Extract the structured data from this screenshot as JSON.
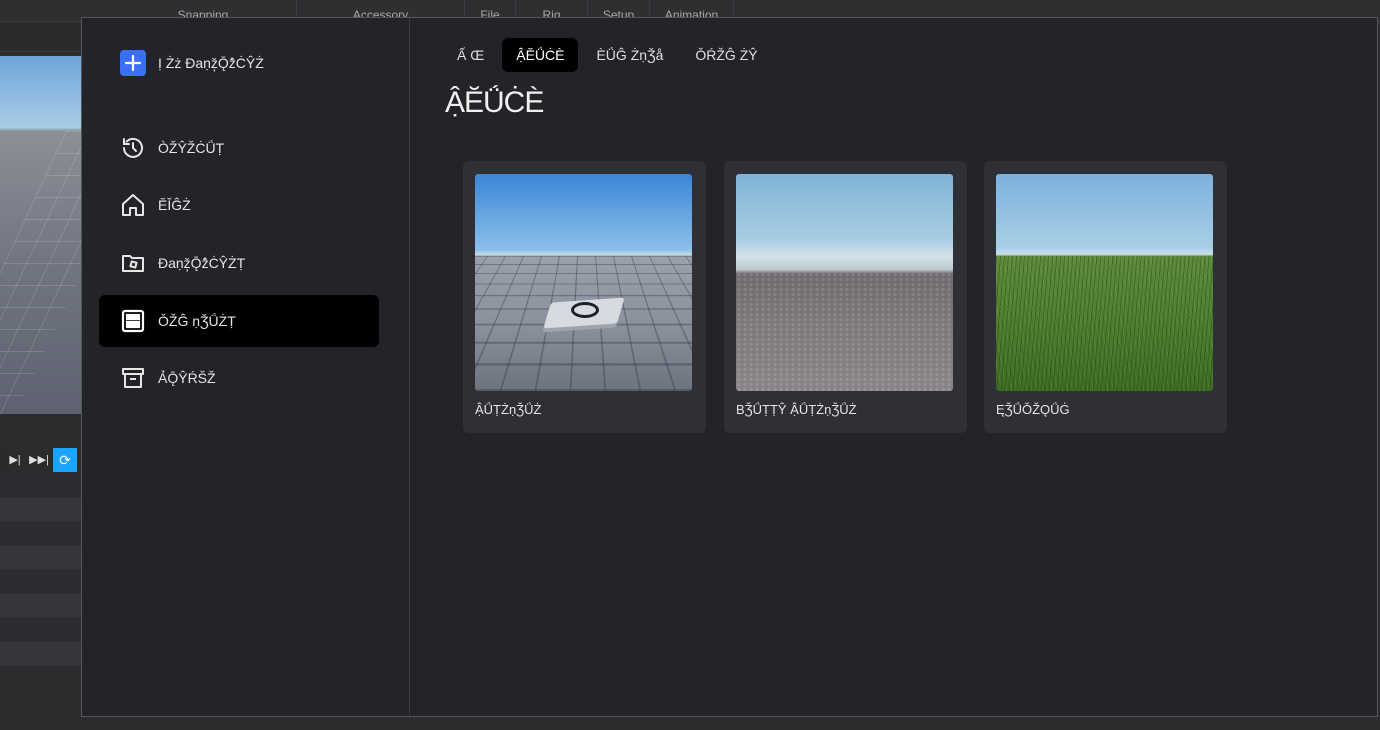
{
  "studio": {
    "top_tabs": [
      "Snapping",
      "Accessory",
      "File",
      "Rig",
      "Setup",
      "Animation"
    ]
  },
  "dialog": {
    "new_project_label": "Ị Żż Đaṇž̦Ǭẑ̊ĊŶŻ",
    "sidebar": {
      "items": [
        {
          "id": "recent",
          "icon": "history-icon",
          "label": "ÒŽŶŽĊǗṬ"
        },
        {
          "id": "home",
          "icon": "home-icon",
          "label": "ĔǏĜŻ"
        },
        {
          "id": "projects",
          "icon": "folder-icon",
          "label": "Đaṇž̦Ǭẑ̊ĊŶŻṬ"
        },
        {
          "id": "templates",
          "icon": "template-icon",
          "label": "ǑŽĜ ṇǮǗŻṬ",
          "active": true
        },
        {
          "id": "archive",
          "icon": "archive-icon",
          "label": "ẢǬŶŔŠŽ"
        }
      ]
    },
    "tabs": [
      {
        "label": "Ấ Œ"
      },
      {
        "label": "ẬĔǗĊÈ",
        "active": true
      },
      {
        "label": "ÈǗĜ ŻṇǮå"
      },
      {
        "label": "ǑŔŽĜ ŻŶ"
      }
    ],
    "section_title": "ẬĔǗĊÈ",
    "cards": [
      {
        "label": "ẬǗṬŻṇǮǗŻ",
        "thumbnail": "baseplate"
      },
      {
        "label": "BǮǗṬṬŶ ẬǗṬŻṇǮǗŻ",
        "thumbnail": "flat-terrain"
      },
      {
        "label": "ĘǮǗǑŽǪǗĠ",
        "thumbnail": "classic"
      }
    ]
  },
  "colors": {
    "accent": "#3b6ff5",
    "active_bg": "#000000",
    "dialog_bg": "#232428",
    "card_bg": "#2e3035",
    "loop_button": "#1aa3ff"
  }
}
